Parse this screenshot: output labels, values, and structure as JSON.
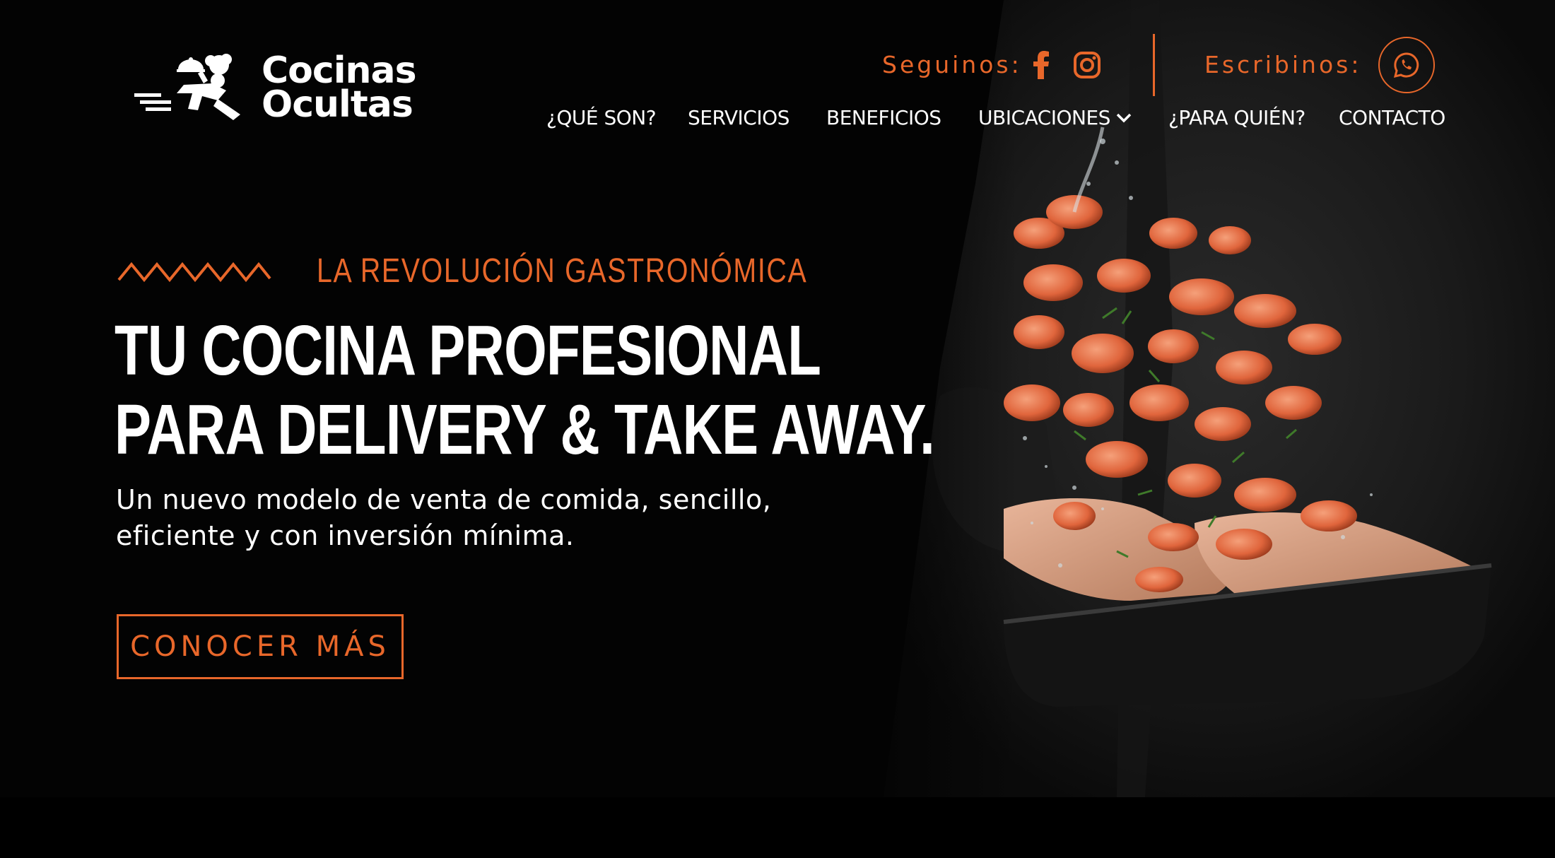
{
  "brand": {
    "line1": "Cocinas",
    "line2": "Ocultas"
  },
  "social": {
    "follow_label": "Seguinos:",
    "write_label": "Escribinos:",
    "facebook_icon": "facebook-icon",
    "instagram_icon": "instagram-icon",
    "whatsapp_icon": "whatsapp-icon"
  },
  "nav": {
    "items": [
      {
        "label": "¿QUÉ SON?"
      },
      {
        "label": "SERVICIOS"
      },
      {
        "label": "BENEFICIOS"
      },
      {
        "label": "UBICACIONES"
      },
      {
        "label": "¿PARA QUIÉN?"
      },
      {
        "label": "CONTACTO"
      }
    ]
  },
  "hero": {
    "eyebrow": "LA REVOLUCIÓN GASTRONÓMICA",
    "headline_line1": "TU COCINA PROFESIONAL",
    "headline_line2": "PARA DELIVERY & TAKE AWAY.",
    "subtext_line1": "Un nuevo modelo de venta de comida, sencillo,",
    "subtext_line2": "eficiente y con inversión mínima.",
    "cta_label": "CONOCER MÁS"
  },
  "colors": {
    "accent": "#e8672a",
    "background": "#030303",
    "text": "#ffffff"
  }
}
